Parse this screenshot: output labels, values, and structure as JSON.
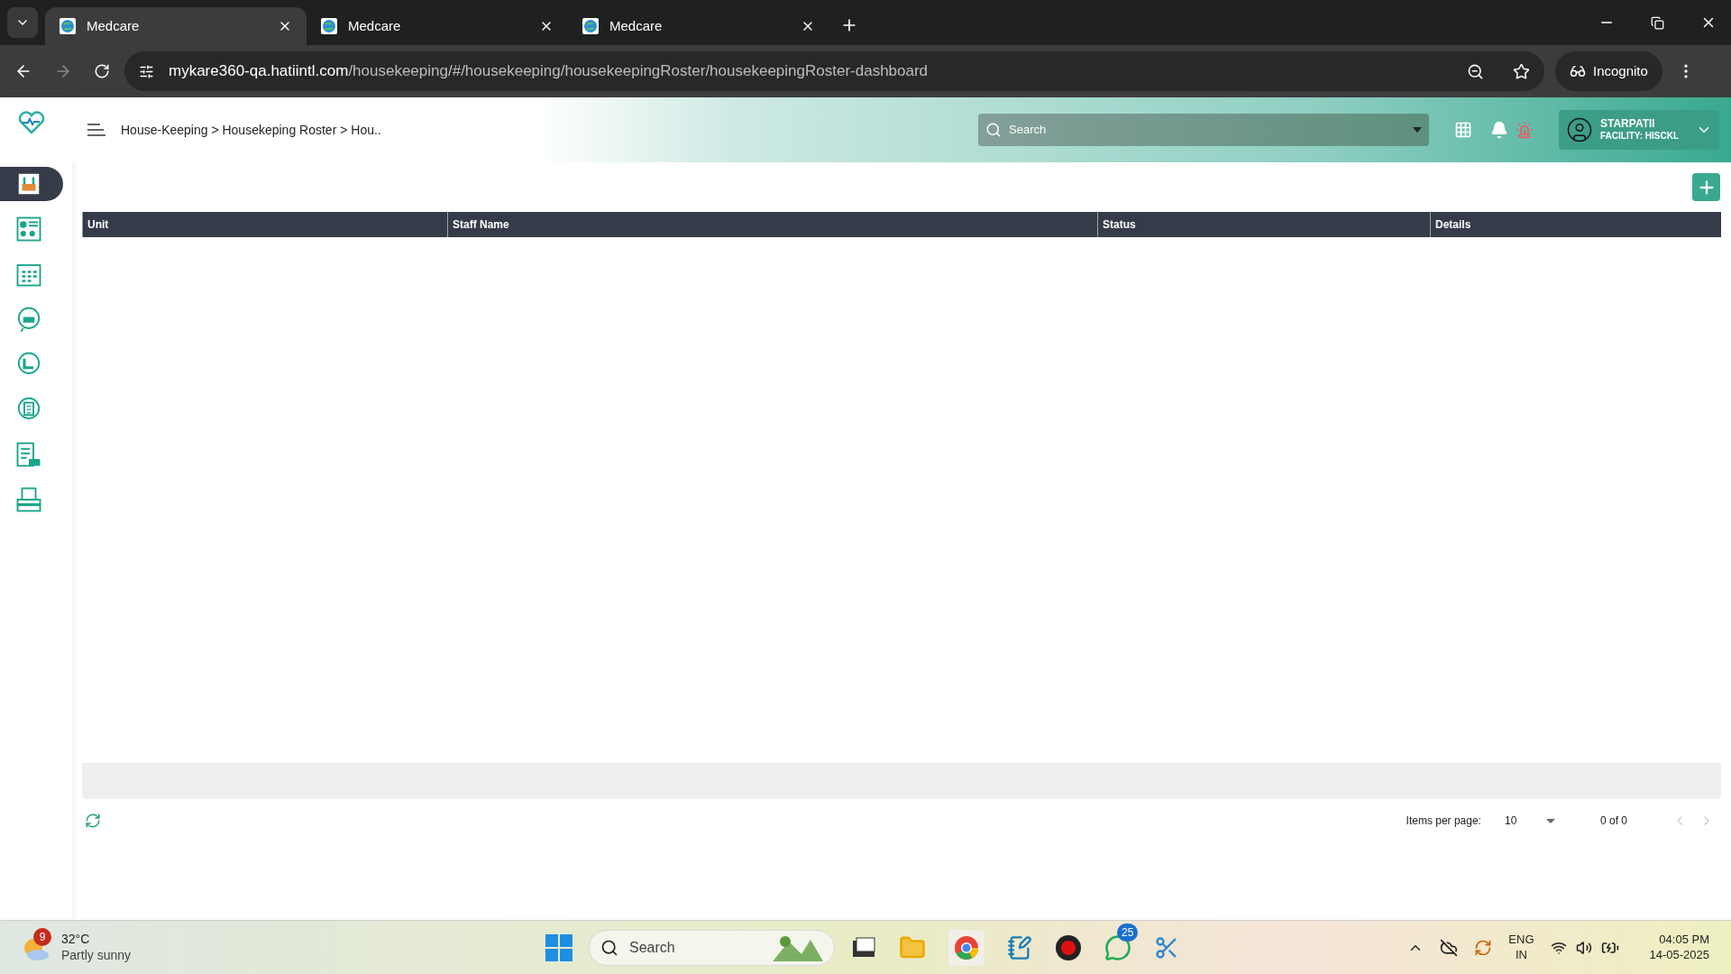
{
  "browser": {
    "tabs": [
      {
        "title": "Medcare",
        "selected": true
      },
      {
        "title": "Medcare",
        "selected": false
      },
      {
        "title": "Medcare",
        "selected": false
      }
    ],
    "url": {
      "domain": "mykare360-qa.hatiintl.com",
      "path": "/housekeeping/#/housekeeping/housekeepingRoster/housekeepingRoster-dashboard"
    },
    "profile": "Incognito"
  },
  "sidebar": {
    "items": [
      {
        "selected": true
      },
      {
        "selected": false
      },
      {
        "selected": false
      },
      {
        "selected": false
      },
      {
        "selected": false
      },
      {
        "selected": false
      },
      {
        "selected": false
      },
      {
        "selected": false
      }
    ]
  },
  "header": {
    "breadcrumb": "House-Keeping > Housekeping Roster > Hou..",
    "search": {
      "placeholder": "Search"
    },
    "user": {
      "name": "STARPATIl",
      "facility": "FACILITY: HISCKL"
    }
  },
  "table": {
    "columns": [
      "Unit",
      "Staff Name",
      "Status",
      "Details"
    ]
  },
  "pagination": {
    "items_label": "Items per page:",
    "page_size": "10",
    "range": "0 of 0"
  },
  "taskbar": {
    "weather": {
      "badge": "9",
      "temp": "32°C",
      "condition": "Partly sunny"
    },
    "search": {
      "placeholder": "Search"
    },
    "whatsapp_badge": "25",
    "language": [
      "ENG",
      "IN"
    ],
    "time": "04:05 PM",
    "date": "14-05-2025"
  }
}
